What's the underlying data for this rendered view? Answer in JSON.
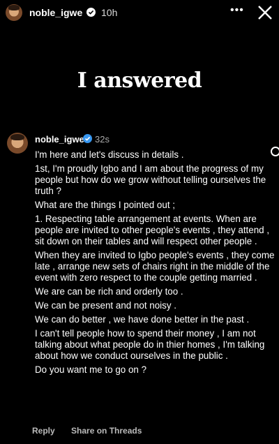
{
  "header": {
    "username": "noble_igwe",
    "time": "10h",
    "more_label": "•••"
  },
  "headline": "I answered",
  "reply": {
    "username": "noble_igwe",
    "time": "32s",
    "paragraphs": [
      "I'm here and let's discuss in details .",
      "1st, I'm proudly Igbo and I am about the progress of my people but how do we grow without telling ourselves the truth ?",
      "What are the things I pointed out ;",
      "1. Respecting table arrangement at events. When are people are invited to other people's events , they attend , sit down on their tables and will respect other people .",
      "When they are invited to Igbo people's events , they come late , arrange new sets of chairs right in the middle of the event with zero respect to the couple getting married .",
      "We are can be rich and orderly too .",
      "We can be present and not noisy .",
      "We can do better , we have done better in the past .",
      "I can't tell people how to spend their money , I am not talking about what people do in thier homes , I'm talking about how we conduct ourselves in the public .",
      "Do you want me to go on ?"
    ],
    "actions": {
      "reply_label": "Reply",
      "threads_label": "Share on Threads"
    }
  },
  "colors": {
    "background": "#000000",
    "verified_badge": "#3897f0"
  }
}
